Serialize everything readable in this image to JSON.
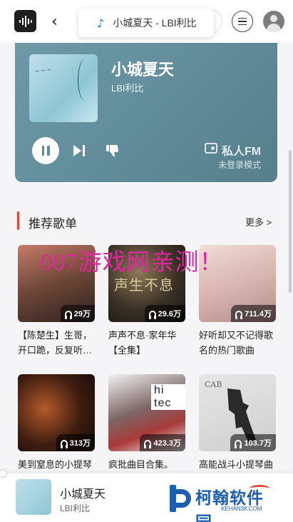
{
  "header": {
    "now_playing": "小城夏天 - LBI利比",
    "back_glyph": "‹"
  },
  "player": {
    "title": "小城夏天",
    "artist": "LBI利比",
    "fm_label": "私人FM",
    "fm_status": "未登录模式",
    "accent": "#5f8a97"
  },
  "section": {
    "title": "推荐歌单",
    "more": "更多 >"
  },
  "watermark": "007游戏网亲测！",
  "playlists": [
    {
      "name": "【陈楚生】生哥，开口跪，反复听…",
      "plays": "29万",
      "cover_text": ""
    },
    {
      "name": "声声不息·家年华【全集】",
      "plays": "29.6万",
      "cover_text": "声生不息"
    },
    {
      "name": "好听却又不记得歌名的热门歌曲",
      "plays": "711.4万",
      "cover_text": ""
    },
    {
      "name": "美到窒息的小提琴",
      "plays": "313万",
      "cover_text": ""
    },
    {
      "name": "疯批曲目合集。",
      "plays": "423.3万",
      "cover_text": "hi tec"
    },
    {
      "name": "高能战斗小提琴曲",
      "plays": "103.7万",
      "cover_text": "CAB"
    }
  ],
  "mini_player": {
    "title": "小城夏天",
    "artist": "LBI利比"
  },
  "brand": {
    "name": "柯翰软件园",
    "url": "KEHAN38.COM",
    "color": "#1d5fae"
  }
}
